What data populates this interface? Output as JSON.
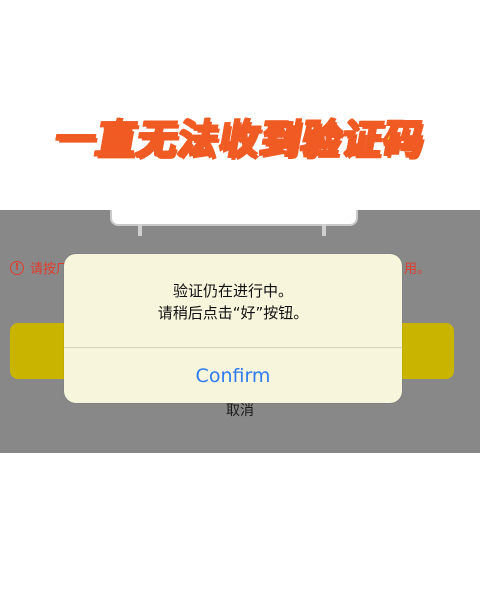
{
  "banner": {
    "title": "一直无法收到验证码"
  },
  "background_screen": {
    "hint_partial_left": "请按厂",
    "hint_partial_right": "用。",
    "cancel_label": "取消"
  },
  "dialog": {
    "message_line1": "验证仍在进行中。",
    "message_line2": "请稍后点击“好”按钮。",
    "confirm_label": "Confirm"
  },
  "colors": {
    "banner_fill": "#ffd21a",
    "banner_outline": "#f05a23",
    "hint_red": "#e23b2c",
    "confirm_blue": "#2e7bf0",
    "primary_button": "#c9b400",
    "overlay_gray": "#888888"
  },
  "icons": {
    "warning": "exclamation-circle-icon"
  }
}
